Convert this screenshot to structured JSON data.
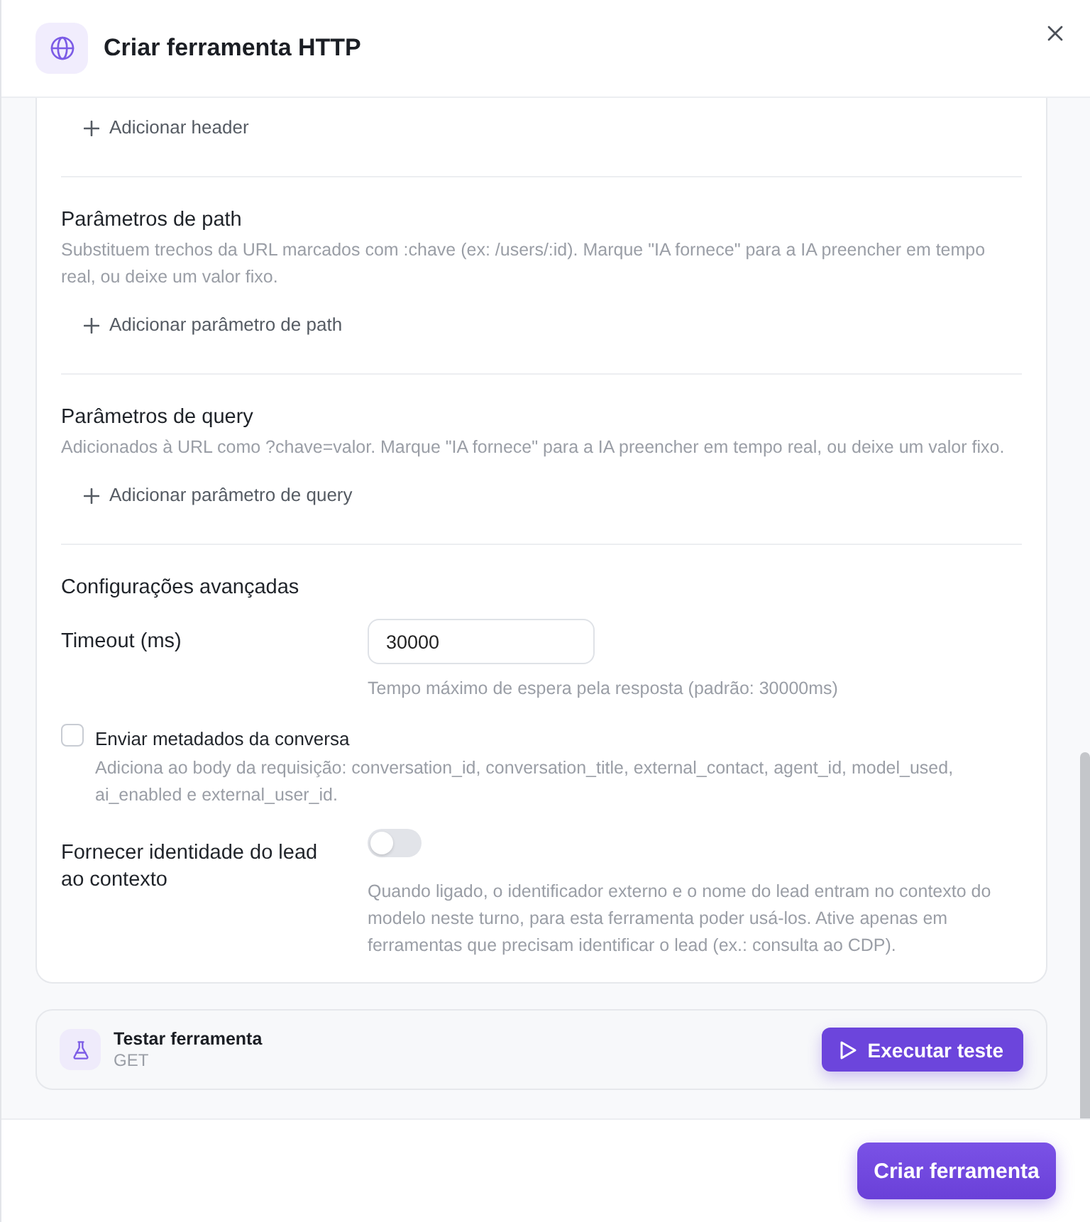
{
  "dialog": {
    "title": "Criar ferramenta HTTP"
  },
  "sections": [
    {
      "add_label": "Adicionar header"
    },
    {
      "title": "Parâmetros de path",
      "description": "Substituem trechos da URL marcados com :chave (ex: /users/:id). Marque \"IA fornece\" para a IA preencher em tempo real, ou deixe um valor fixo.",
      "add_label": "Adicionar parâmetro de path"
    },
    {
      "title": "Parâmetros de query",
      "description": "Adicionados à URL como ?chave=valor. Marque \"IA fornece\" para a IA preencher em tempo real, ou deixe um valor fixo.",
      "add_label": "Adicionar parâmetro de query"
    }
  ],
  "advanced": {
    "title": "Configurações avançadas",
    "timeout": {
      "label": "Timeout (ms)",
      "value": "30000",
      "help": "Tempo máximo de espera pela resposta (padrão: 30000ms)"
    },
    "metadata": {
      "label": "Enviar metadados da conversa",
      "checked": false,
      "description": "Adiciona ao body da requisição: conversation_id, conversation_title, external_contact, agent_id, model_used, ai_enabled e external_user_id."
    },
    "lead_identity": {
      "label": "Fornecer identidade do lead ao contexto",
      "on": false,
      "description": "Quando ligado, o identificador externo e o nome do lead entram no contexto do modelo neste turno, para esta ferramenta poder usá-los. Ative apenas em ferramentas que precisam identificar o lead (ex.: consulta ao CDP)."
    }
  },
  "test_panel": {
    "title": "Testar ferramenta",
    "method": "GET",
    "button": "Executar teste"
  },
  "footer": {
    "button": "Criar ferramenta"
  }
}
